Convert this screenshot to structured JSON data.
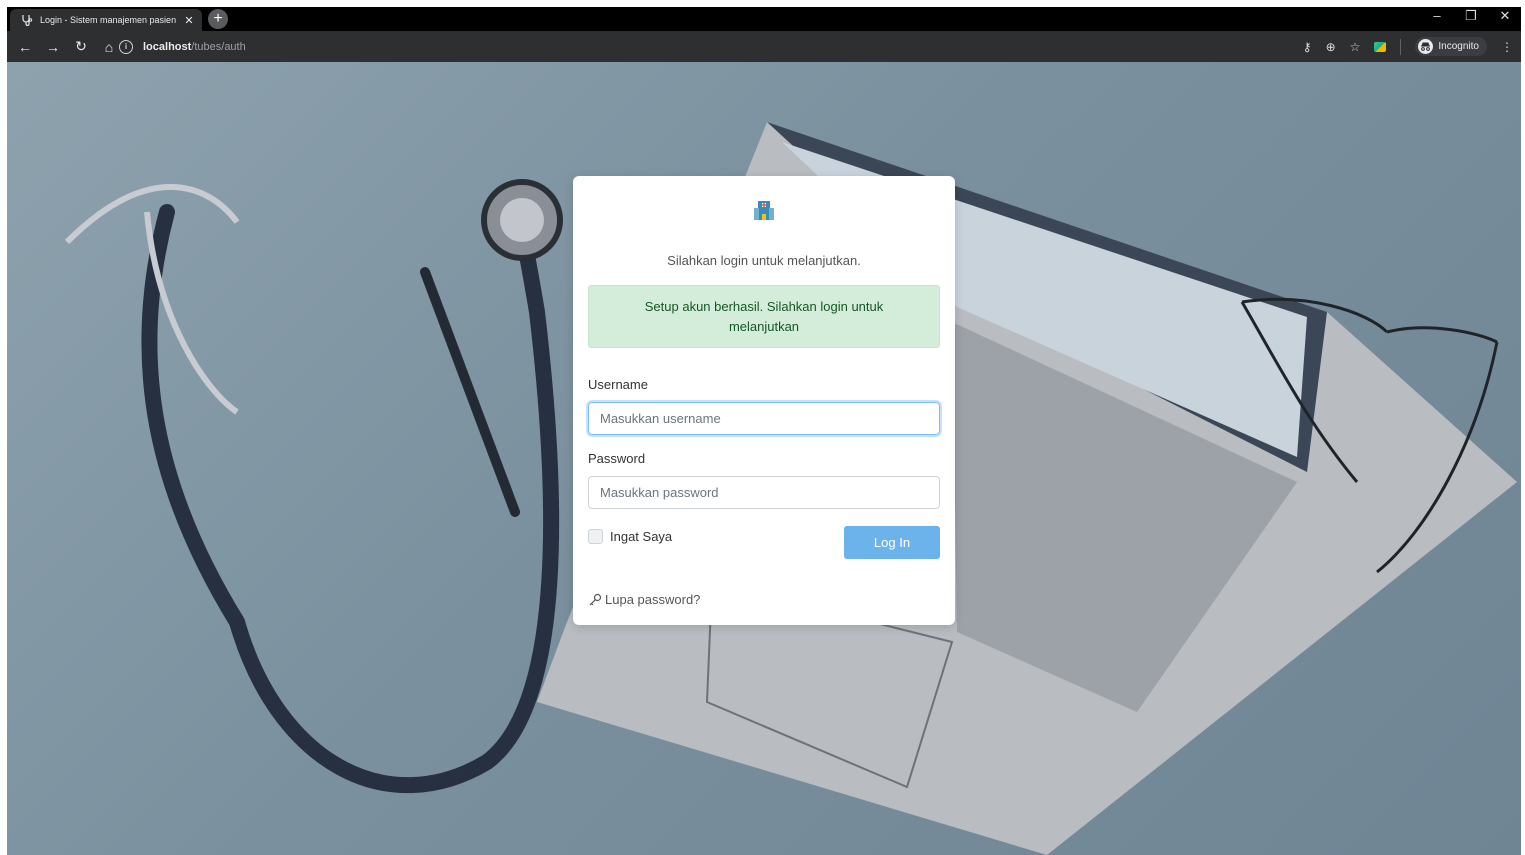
{
  "browser": {
    "tab_title": "Login - Sistem manajemen pasien",
    "tab_close": "✕",
    "new_tab": "+",
    "url_host": "localhost",
    "url_path": "/tubes/auth",
    "incognito_label": "Incognito",
    "window_controls": {
      "minimize": "–",
      "restore": "❐",
      "close": "✕"
    },
    "nav": {
      "back": "←",
      "forward": "→",
      "reload": "↻",
      "home": "⌂"
    },
    "toolbar_icons": {
      "key": "⚷",
      "zoom": "⊕",
      "star": "☆",
      "menu": "⋮"
    }
  },
  "login": {
    "subtitle": "Silahkan login untuk melanjutkan.",
    "alert": "Setup akun berhasil. Silahkan login untuk melanjutkan",
    "username_label": "Username",
    "username_placeholder": "Masukkan username",
    "password_label": "Password",
    "password_placeholder": "Masukkan password",
    "remember_label": "Ingat Saya",
    "login_button": "Log In",
    "forgot_label": "Lupa password?"
  },
  "colors": {
    "alert_bg": "#d4edda",
    "alert_text": "#155724",
    "button": "#6cb2eb",
    "background": "#7f95a3"
  }
}
